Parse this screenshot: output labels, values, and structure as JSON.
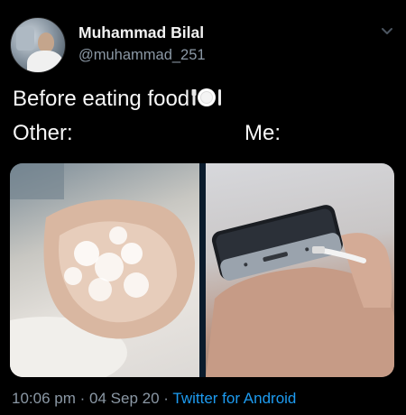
{
  "tweet": {
    "author_name": "Muhammad Bilal",
    "handle": "@muhammad_251",
    "line1": "Before eating food",
    "line2_left": "Other:",
    "line2_right": "Me:",
    "emoji": "plate-with-cutlery",
    "media": {
      "left_panel": "hand-washing-with-soap",
      "right_panel": "phone-being-charged"
    },
    "time": "10:06 pm",
    "date": "04 Sep 20",
    "source": "Twitter for Android",
    "separator": "·"
  },
  "colors": {
    "background": "#000000",
    "text_primary": "#f2f2f2",
    "text_secondary": "#8b98a5",
    "link": "#1d9bf0"
  },
  "icons": {
    "menu": "chevron-down-icon"
  }
}
